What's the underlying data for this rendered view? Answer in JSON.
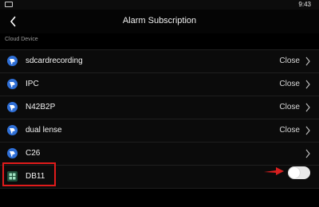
{
  "status_bar": {
    "time": "9:43"
  },
  "header": {
    "title": "Alarm Subscription",
    "back_icon": "chevron-left-icon"
  },
  "section": {
    "label": "Cloud Device"
  },
  "devices": [
    {
      "name": "sdcardrecording",
      "status": "Close",
      "icon": "camera-icon"
    },
    {
      "name": "IPC",
      "status": "Close",
      "icon": "camera-icon"
    },
    {
      "name": "N42B2P",
      "status": "Close",
      "icon": "camera-icon"
    },
    {
      "name": "dual lense",
      "status": "Close",
      "icon": "camera-icon"
    },
    {
      "name": "C26",
      "status": "",
      "icon": "camera-icon"
    },
    {
      "name": "DB11",
      "status": "",
      "icon": "doorbell-icon",
      "toggle": "off"
    }
  ],
  "colors": {
    "background": "#000000",
    "row": "#0b0b0b",
    "accent_icon": "#2f6fd6",
    "highlight": "#e01b1b"
  }
}
